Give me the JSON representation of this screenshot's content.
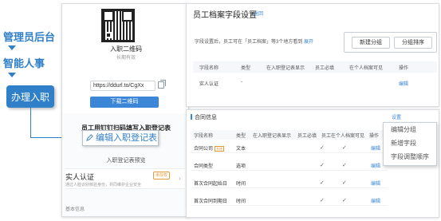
{
  "flow": {
    "step1": "管理员后台",
    "step2": "智能人事",
    "button": "办理入职"
  },
  "phone": {
    "qr_title": "入职二维码",
    "qr_subtitle": "长期有效",
    "url_value": "https://ddurl.to/CgXx",
    "download_button": "下载二维码",
    "form_title": "员工用钉钉扫码填写入职登记表",
    "callout": "编辑入职登记表",
    "preview_title": "入职登记表预览",
    "cert_label": "实人认证",
    "cert_badge": "未授权",
    "cert_desc": "通过人脸识别核验身份，共同维护企业安全",
    "basic_info": "基本信息"
  },
  "settings": {
    "title": "员工档案字段设置",
    "title_link": "返回",
    "desc": "字段设置后，员工可在「员工档案」等3个地方看到",
    "desc_link": "展开",
    "btn_new_group": "新建分组",
    "btn_group_sort": "分组排序",
    "columns": [
      "字段名称",
      "类型",
      "在入职登记表显示",
      "员工必填",
      "在个人档案可见",
      "操作"
    ],
    "row": {
      "name": "实人认证",
      "type": "-",
      "action": "编辑"
    }
  },
  "contract": {
    "title": "合同信息",
    "settings_label": "设置",
    "columns": [
      "字段名称",
      "类型",
      "在入职登记表显示",
      "员工必填",
      "员工在个人档案可见",
      "操作"
    ],
    "rows": [
      {
        "name": "合同公司",
        "tag": "系统",
        "type": "文本",
        "action": "编辑"
      },
      {
        "name": "合同类型",
        "type": "选项",
        "action": "编辑"
      },
      {
        "name": "首次合同起始日",
        "type": "时间",
        "action": "编辑"
      },
      {
        "name": "首次合同到期日",
        "type": "时间",
        "action": "编辑"
      }
    ],
    "dropdown": [
      "编辑分组",
      "新增字段",
      "字段调整顺序"
    ]
  },
  "colors": {
    "accent": "#2f7fc9",
    "link": "#3b86d6",
    "badge": "#e29a3a"
  }
}
